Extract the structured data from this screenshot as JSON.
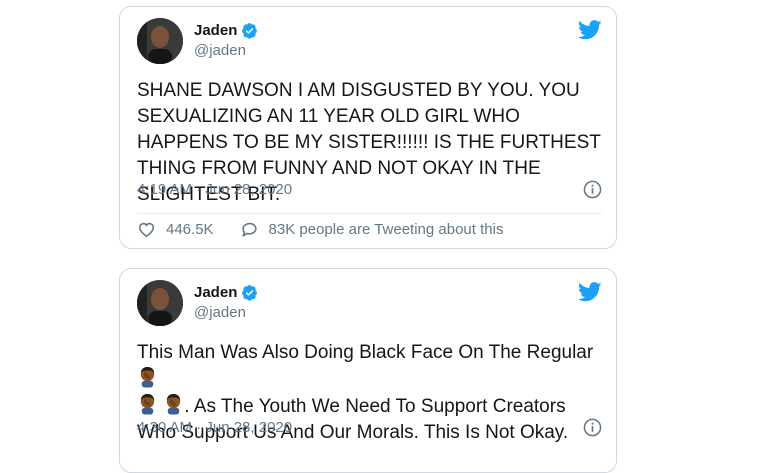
{
  "tweets": [
    {
      "author_name": "Jaden",
      "handle": "@jaden",
      "text": "SHANE DAWSON I AM DISGUSTED BY YOU. YOU SEXUALIZING AN 11 YEAR OLD GIRL WHO HAPPENS TO BE MY SISTER!!!!!!  IS THE FURTHEST THING FROM FUNNY AND NOT OKAY IN THE SLIGHTEST BIT.",
      "timestamp": "4:19 AM · Jun 28, 2020",
      "likes": "446.5K",
      "discussion": "83K people are Tweeting about this"
    },
    {
      "author_name": "Jaden",
      "handle": "@jaden",
      "text_part1": "This Man Was Also Doing Black Face On The Regular",
      "text_part2": ". As The Youth We Need To Support Creators Who Support Us And Our Morals. This Is Not Okay.",
      "timestamp": "4:30 AM · Jun 28, 2020"
    }
  ],
  "icons": {
    "verified": "verified-badge-icon",
    "brand": "twitter-bird-icon",
    "info": "info-icon",
    "like": "heart-icon",
    "reply": "speech-bubble-icon",
    "emoji": "man-facepalming-medium-dark-skin-emoji"
  },
  "colors": {
    "brand_blue": "#1da1f2",
    "secondary_text": "#657786",
    "border": "#cfd9de"
  }
}
